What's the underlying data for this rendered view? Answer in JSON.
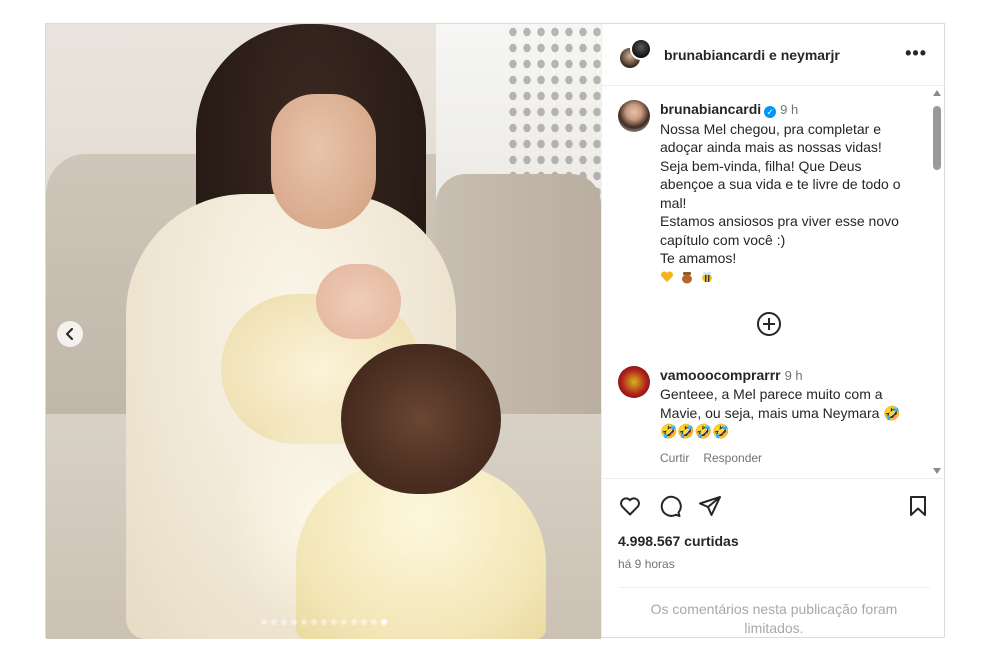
{
  "header": {
    "title": "brunabiancardi e neymarjr",
    "more_label": "•••"
  },
  "comments": [
    {
      "username": "brunabiancardi",
      "verified": true,
      "time": "9 h",
      "lines": [
        "Nossa Mel chegou, pra completar e",
        "adoçar ainda mais as nossas vidas!",
        "Seja bem-vinda, filha! Que Deus",
        "abençoe a sua vida e te livre de todo o",
        "mal!",
        "Estamos ansiosos pra viver esse novo",
        "capítulo com você :)",
        "Te amamos!"
      ],
      "emojis": [
        "yellow-heart",
        "honey-pot",
        "bee"
      ]
    },
    {
      "username": "vamooocomprarrr",
      "time": "9 h",
      "lines": [
        "Genteee, a Mel parece muito com a",
        "Mavie, ou seja, mais uma Neymara 🤣",
        "🤣🤣🤣🤣"
      ],
      "like_label": "Curtir",
      "reply_label": "Responder"
    }
  ],
  "footer": {
    "likes": "4.998.567 curtidas",
    "ago": "há 9 horas",
    "limited_line1": "Os comentários nesta publicação foram",
    "limited_line2": "limitados."
  },
  "icons": [
    "heart-icon",
    "comment-icon",
    "share-icon",
    "bookmark-icon",
    "plus-circle-icon",
    "chevron-left-icon"
  ],
  "carousel": {
    "slide_count": 13,
    "active_index": 12
  },
  "colors": {
    "verified": "#0095f6",
    "text": "#262626",
    "muted": "#737373",
    "border": "#dbdbdb"
  }
}
